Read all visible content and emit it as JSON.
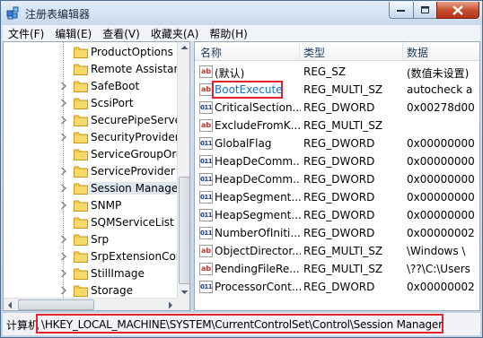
{
  "window": {
    "title": "注册表编辑器"
  },
  "menubar": {
    "items": [
      "文件(F)",
      "编辑(E)",
      "查看(V)",
      "收藏夹(A)",
      "帮助(H)"
    ]
  },
  "tree": {
    "items": [
      {
        "label": "ProductOptions",
        "expandable": false
      },
      {
        "label": "Remote Assistanc",
        "expandable": false
      },
      {
        "label": "SafeBoot",
        "expandable": true
      },
      {
        "label": "ScsiPort",
        "expandable": true
      },
      {
        "label": "SecurePipeServer",
        "expandable": true
      },
      {
        "label": "SecurityProviders",
        "expandable": true
      },
      {
        "label": "ServiceGroupOrd",
        "expandable": false
      },
      {
        "label": "ServiceProvider",
        "expandable": true
      },
      {
        "label": "Session Manager",
        "expandable": true,
        "selected": true
      },
      {
        "label": "SNMP",
        "expandable": true
      },
      {
        "label": "SQMServiceList",
        "expandable": false
      },
      {
        "label": "Srp",
        "expandable": true
      },
      {
        "label": "SrpExtensionConf",
        "expandable": true
      },
      {
        "label": "StillImage",
        "expandable": true
      },
      {
        "label": "Storage",
        "expandable": true
      }
    ]
  },
  "list": {
    "columns": [
      "名称",
      "类型",
      "数据"
    ],
    "rows": [
      {
        "icon": "string-value-icon",
        "name": "(默认)",
        "type": "REG_SZ",
        "data": "(数值未设置)"
      },
      {
        "icon": "string-value-icon",
        "name": "BootExecute",
        "type": "REG_MULTI_SZ",
        "data": "autocheck a",
        "highlighted": true
      },
      {
        "icon": "binary-value-icon",
        "name": "CriticalSection...",
        "type": "REG_DWORD",
        "data": "0x00278d00"
      },
      {
        "icon": "string-value-icon",
        "name": "ExcludeFromK...",
        "type": "REG_MULTI_SZ",
        "data": ""
      },
      {
        "icon": "binary-value-icon",
        "name": "GlobalFlag",
        "type": "REG_DWORD",
        "data": "0x00000000"
      },
      {
        "icon": "binary-value-icon",
        "name": "HeapDeComm...",
        "type": "REG_DWORD",
        "data": "0x00000000"
      },
      {
        "icon": "binary-value-icon",
        "name": "HeapDeComm...",
        "type": "REG_DWORD",
        "data": "0x00000000"
      },
      {
        "icon": "binary-value-icon",
        "name": "HeapSegment...",
        "type": "REG_DWORD",
        "data": "0x00000000"
      },
      {
        "icon": "binary-value-icon",
        "name": "HeapSegment...",
        "type": "REG_DWORD",
        "data": "0x00000000"
      },
      {
        "icon": "binary-value-icon",
        "name": "NumberOfIniti...",
        "type": "REG_DWORD",
        "data": "0x00000002"
      },
      {
        "icon": "string-value-icon",
        "name": "ObjectDirector...",
        "type": "REG_MULTI_SZ",
        "data": "\\Windows \\"
      },
      {
        "icon": "string-value-icon",
        "name": "PendingFileRe...",
        "type": "REG_MULTI_SZ",
        "data": "\\??\\C:\\Users"
      },
      {
        "icon": "binary-value-icon",
        "name": "ProcessorCont...",
        "type": "REG_DWORD",
        "data": "0x00000002"
      }
    ]
  },
  "statusbar": {
    "prefix": "计算机",
    "path": "\\HKEY_LOCAL_MACHINE\\SYSTEM\\CurrentControlSet\\Control\\Session Manager"
  },
  "colors": {
    "highlight_border": "#e1242b",
    "selected_text": "#1d6fd1"
  },
  "icon_text": {
    "string": "ab",
    "binary": "011"
  }
}
